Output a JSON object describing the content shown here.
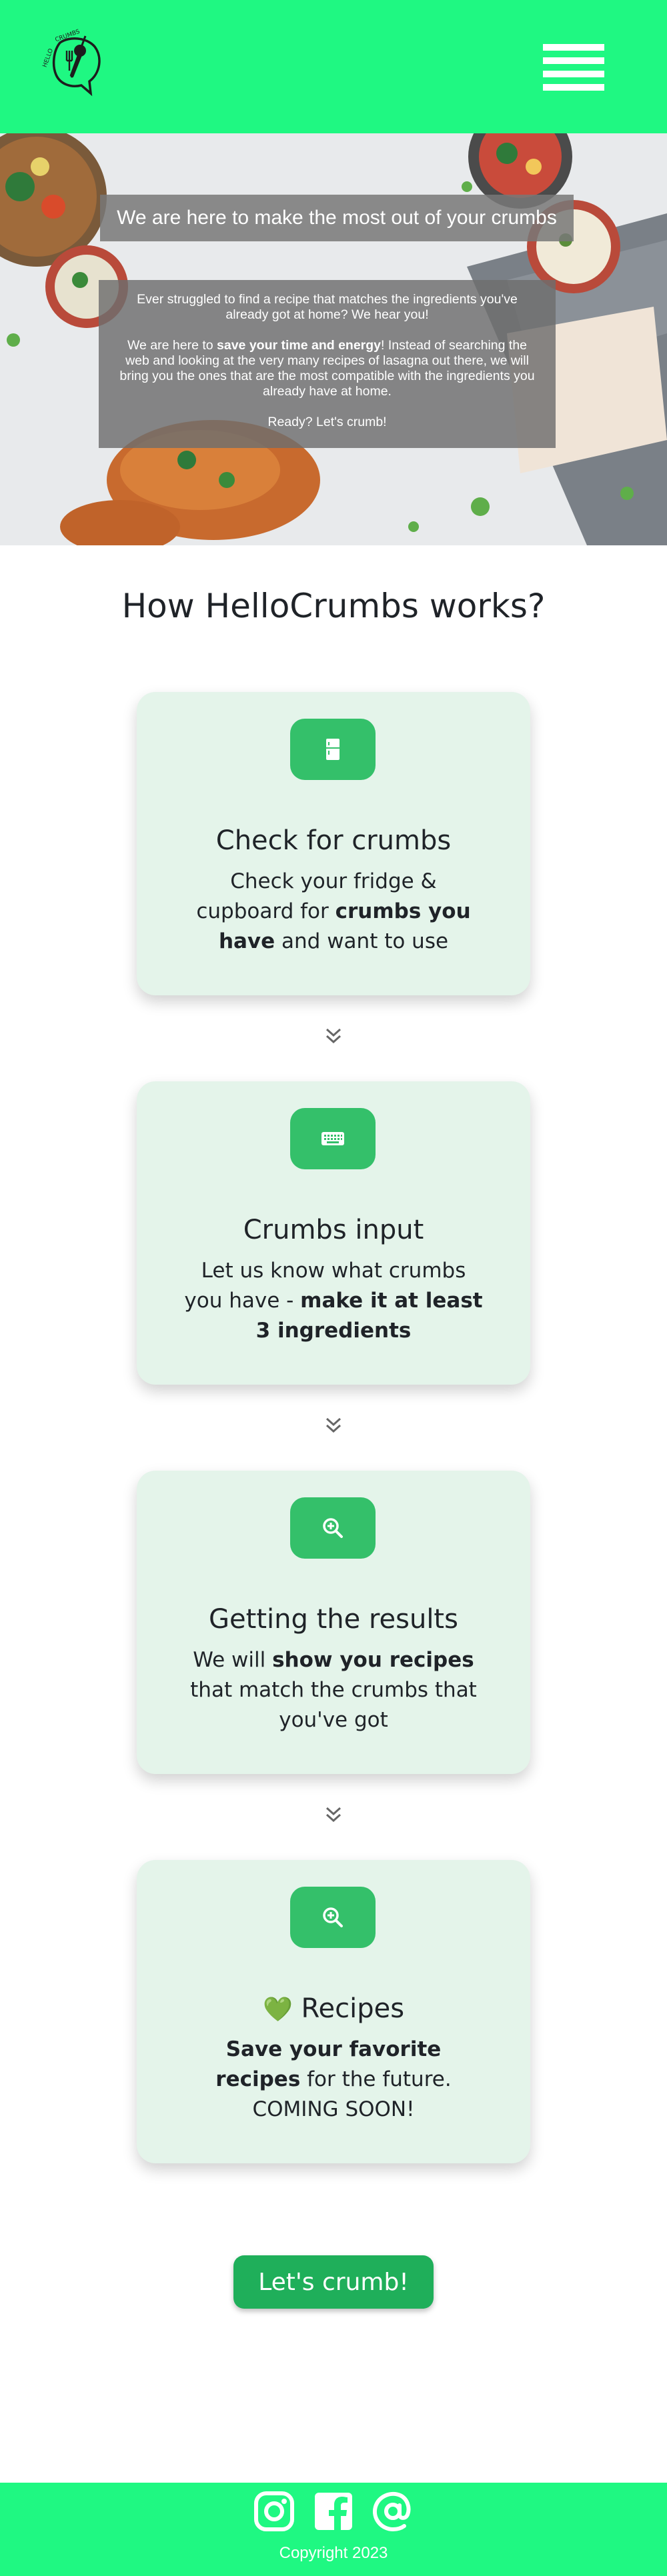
{
  "header": {
    "logo_text": "HELLO CRUMBS",
    "menu_icon": "hamburger-menu-icon",
    "brand_color": "#1ff882"
  },
  "hero": {
    "title": "We are here to make the most out of your crumbs",
    "p1": "Ever struggled to find a recipe that matches the ingredients you've already got at home? We hear you!",
    "p2_pre": "We are here to ",
    "p2_bold": "save your time and energy",
    "p2_post": "! Instead of searching the web and looking at the very many recipes of lasagna out there, we will bring you the ones that are the most compatible with the ingredients you already have at home.",
    "p3": "Ready? Let's crumb!"
  },
  "how": {
    "title": "How HelloCrumbs works?",
    "cards": [
      {
        "icon": "fridge-icon",
        "title": "Check for crumbs",
        "desc_pre": "Check your fridge & cupboard for ",
        "desc_bold": "crumbs you have",
        "desc_post": " and want to use"
      },
      {
        "icon": "keyboard-icon",
        "title": "Crumbs input",
        "desc_pre": "Let us know what crumbs you have - ",
        "desc_bold": "make it at least 3 ingredients",
        "desc_post": ""
      },
      {
        "icon": "zoom-in-icon",
        "title": "Getting the results",
        "desc_pre": "We will ",
        "desc_bold": "show you recipes",
        "desc_post": " that match the crumbs that you've got"
      },
      {
        "icon": "zoom-in-icon",
        "title_emoji": "💚",
        "title": "Recipes",
        "desc_bold": "Save your favorite recipes",
        "desc_post": " for the future.",
        "desc_line2": "COMING SOON!"
      }
    ],
    "card_bg": "#e4f4ea",
    "icon_bg": "#34c06a"
  },
  "cta": {
    "label": "Let's crumb!",
    "color": "#1faf5a"
  },
  "footer": {
    "icons": [
      "instagram-icon",
      "facebook-icon",
      "at-sign-icon"
    ],
    "copyright": "Copyright 2023"
  }
}
